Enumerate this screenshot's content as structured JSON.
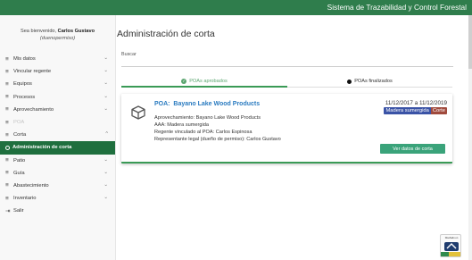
{
  "header": {
    "title": "Sistema de Trazabilidad y Control Forestal"
  },
  "sidebar": {
    "welcome_prefix": "Sea bienvenido, ",
    "user_name": "Carlos Gustavo",
    "role": "(duenopermiso)",
    "items": [
      {
        "label": "Mis datos",
        "state": "collapsed"
      },
      {
        "label": "Vincular regente",
        "state": "collapsed"
      },
      {
        "label": "Equipos",
        "state": "collapsed"
      },
      {
        "label": "Procesos",
        "state": "collapsed"
      },
      {
        "label": "Aprovechamiento",
        "state": "collapsed"
      },
      {
        "label": "POA",
        "state": "disabled"
      },
      {
        "label": "Corta",
        "state": "expanded"
      },
      {
        "label": "Administración de corta",
        "state": "active"
      },
      {
        "label": "Patio",
        "state": "collapsed"
      },
      {
        "label": "Guía",
        "state": "collapsed"
      },
      {
        "label": "Abastecimiento",
        "state": "collapsed"
      },
      {
        "label": "Inventario",
        "state": "collapsed"
      },
      {
        "label": "Salir",
        "state": "none"
      }
    ]
  },
  "main": {
    "title": "Administración de corta",
    "search": {
      "label": "Buscar",
      "placeholder": "",
      "value": ""
    },
    "tabs": [
      {
        "label": "POAs aprobados",
        "active": true
      },
      {
        "label": "POAs finalizados",
        "active": false
      }
    ],
    "card": {
      "poa_label": "POA:",
      "poa_name": "Bayano Lake Wood Products",
      "dates": "11/12/2017 a 11/12/2019",
      "badges": [
        "Madera sumergida",
        "Corte"
      ],
      "details": [
        "Aprovechamiento:  Bayano Lake Wood Products",
        "AAA:  Madera sumergida",
        "Regente vinculado al POA:  Carlos Espinosa",
        "Representante legal (dueño de permiso):  Carlos Gustavo"
      ],
      "button_label": "Ver datos de corta"
    }
  },
  "colors": {
    "brand_green": "#2f7d4c",
    "active_menu": "#1f6f3e",
    "link_blue": "#2a7bc0",
    "badge_species": "#3a53a6",
    "badge_type": "#a04a3d",
    "button": "#3aa37a"
  },
  "logo": {
    "caption": "Diseñado en"
  }
}
